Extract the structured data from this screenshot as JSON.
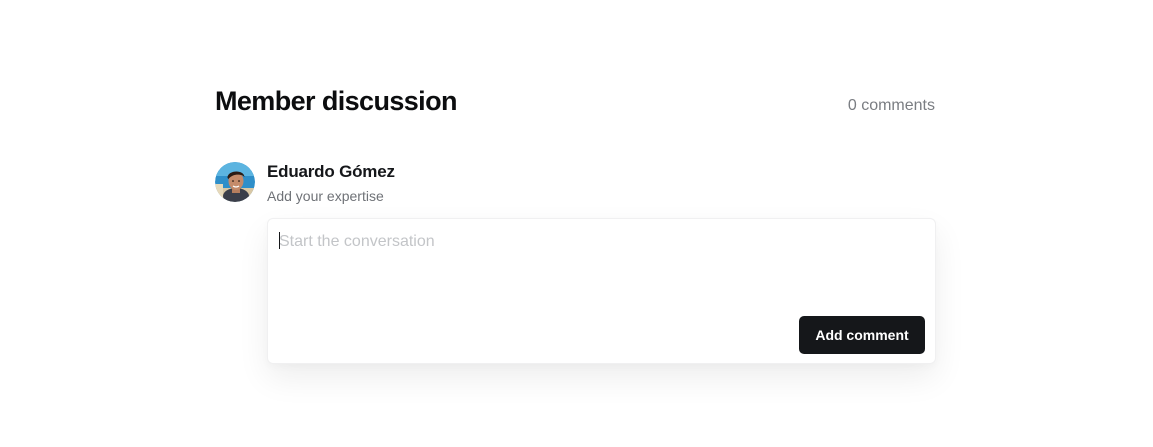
{
  "discussion": {
    "title": "Member discussion",
    "comment_count": "0 comments"
  },
  "author": {
    "name": "Eduardo Gómez",
    "expertise_prompt": "Add your expertise"
  },
  "comment_form": {
    "placeholder": "Start the conversation",
    "value": "",
    "submit_label": "Add comment"
  },
  "colors": {
    "button_bg": "#15171a",
    "button_text": "#ffffff",
    "muted_text": "#7a7d82",
    "placeholder": "#c3c5c8"
  }
}
